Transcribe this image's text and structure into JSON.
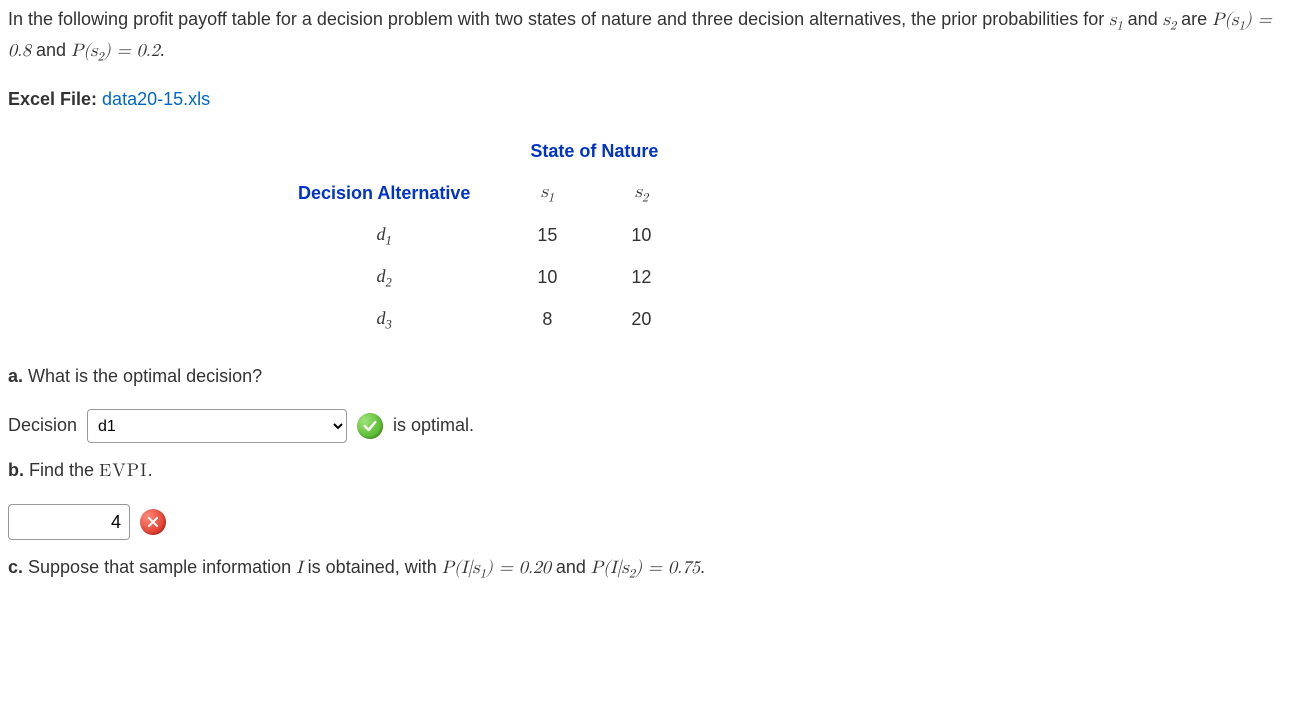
{
  "intro": {
    "text_before_s1": "In the following profit payoff table for a decision problem with two states of nature and three decision alternatives, the prior probabilities for ",
    "s1": "s",
    "sub1": "1",
    "text_and": " and ",
    "s2": "s",
    "sub2": "2",
    "text_are": " are ",
    "ps1": "P(s",
    "ps1_sub": "1",
    "ps1_close": ") = 0.8",
    "and2": " and ",
    "ps2": "P(s",
    "ps2_sub": "2",
    "ps2_close": ") = 0.2",
    "period": "."
  },
  "file_line": {
    "label": "Excel File: ",
    "link": "data20-15.xls"
  },
  "table": {
    "state_header": "State of Nature",
    "decision_header": "Decision Alternative",
    "s1_label": "s",
    "s1_sub": "1",
    "s2_label": "s",
    "s2_sub": "2",
    "rows": [
      {
        "label": "d",
        "sub": "1",
        "v1": "15",
        "v2": "10"
      },
      {
        "label": "d",
        "sub": "2",
        "v1": "10",
        "v2": "12"
      },
      {
        "label": "d",
        "sub": "3",
        "v1": "8",
        "v2": "20"
      }
    ]
  },
  "qa": {
    "a_label": "a.",
    "a_text": " What is the optimal decision?",
    "decision_word": "Decision",
    "decision_value": "d1",
    "is_optimal": " is optimal.",
    "b_label": "b.",
    "b_text": " Find the ",
    "evpi": "EVPI",
    "b_period": ".",
    "evpi_value": "4",
    "c_label": "c.",
    "c_text_1": " Suppose that sample information ",
    "I": "I",
    "c_text_2": " is obtained, with ",
    "pIs1": "P(I|s",
    "pIs1_sub": "1",
    "pIs1_close": ") = 0.20",
    "c_and": " and ",
    "pIs2": "P(I|s",
    "pIs2_sub": "2",
    "pIs2_close": ") = 0.75",
    "c_period": "."
  }
}
